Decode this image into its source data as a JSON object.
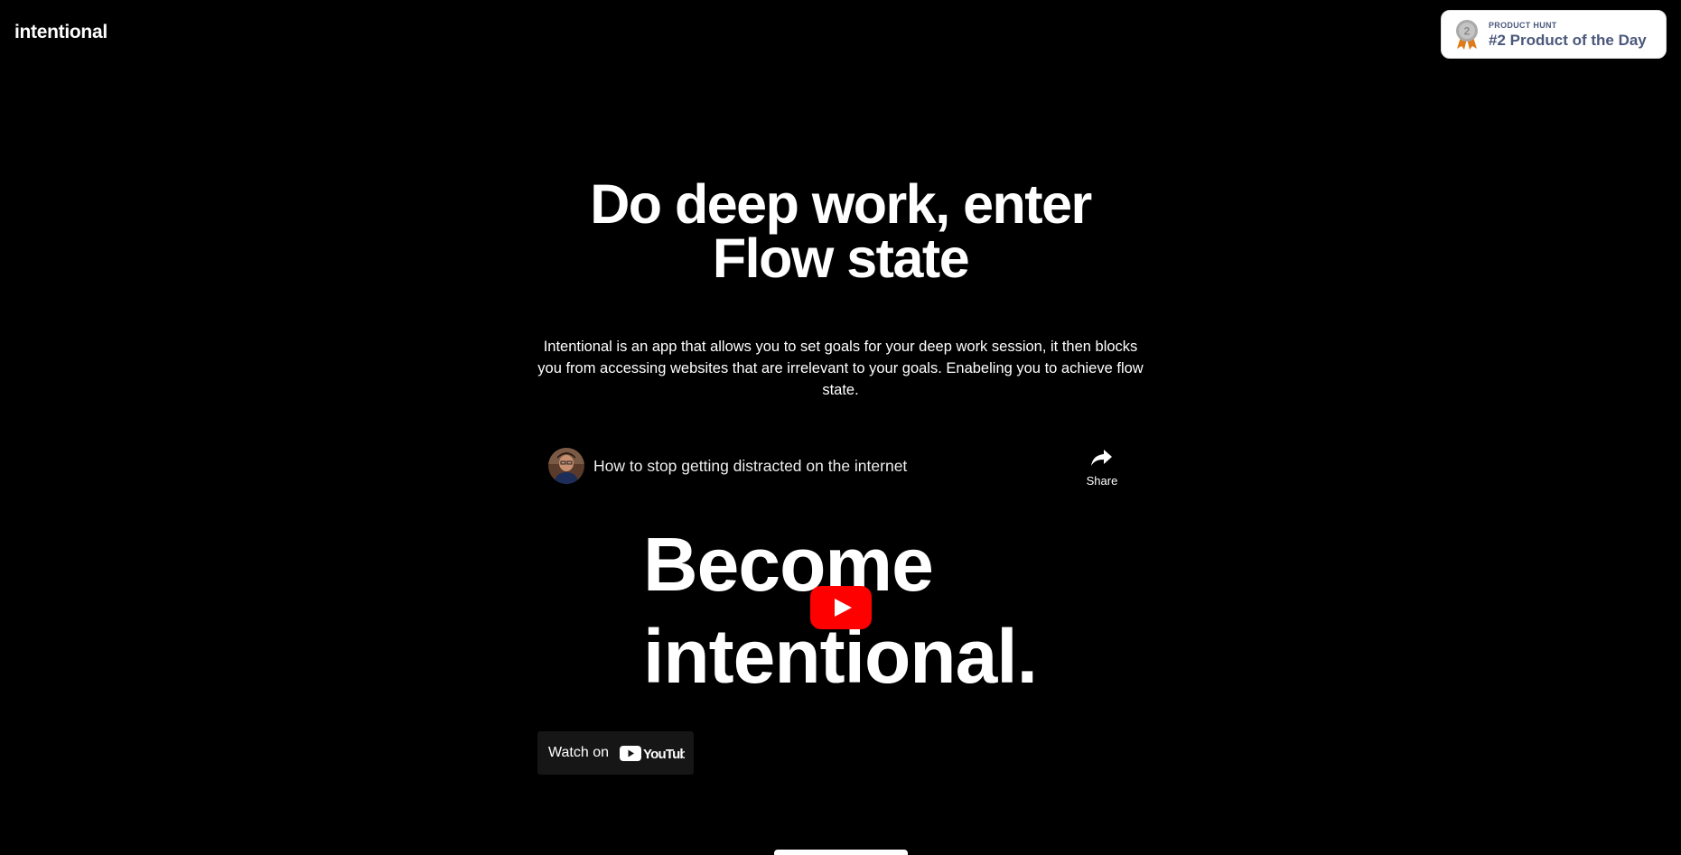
{
  "header": {
    "logo": "intentional",
    "product_hunt": {
      "kicker": "PRODUCT HUNT",
      "title": "#2 Product of the Day",
      "medal_number": "2"
    }
  },
  "hero": {
    "title_line1": "Do deep work, enter",
    "title_line2": "Flow state",
    "description": "Intentional is an app that allows you to set goals for your deep work session, it then blocks you from accessing websites that are irrelevant to your goals. Enabeling you to achieve flow state."
  },
  "video": {
    "title": "How to stop getting distracted on the internet",
    "share_label": "Share",
    "thumbnail_line1": "Become",
    "thumbnail_line2": "intentional.",
    "watch_on_label": "Watch on",
    "youtube_wordmark": "YouTube"
  },
  "colors": {
    "background": "#000000",
    "text": "#ffffff",
    "badge_text": "#4b587c",
    "youtube_red": "#ff0000"
  }
}
